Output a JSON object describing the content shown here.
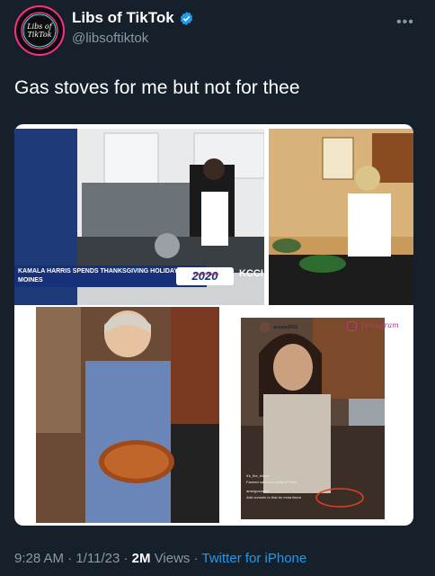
{
  "account": {
    "display_name": "Libs of TikTok",
    "handle": "@libsoftiktok",
    "avatar_text_line1": "Libs of",
    "avatar_text_line2": "TikTok"
  },
  "tweet": {
    "text": "Gas stoves for me but not for thee"
  },
  "media": {
    "chyron_text": "KAMALA HARRIS SPENDS THANKSGIVING HOLIDAY IN DES MOINES",
    "chyron_badge_small": "COUNTDOWN",
    "chyron_badge": "2020",
    "station_logo": "KCCI",
    "instagram_user": "ocasio2018",
    "instagram_brand": "Instagram",
    "comment_1_user": "it's_the_bloom",
    "comment_1_text": "Farmed salmon's pretty s**t tbh",
    "comment_2_user": "amargowayist",
    "comment_2_text": "Add cummin to that for extra flavor"
  },
  "footer": {
    "time": "9:28 AM",
    "date": "1/11/23",
    "views_count": "2M",
    "views_label": "Views",
    "source": "Twitter for iPhone",
    "separator": "·"
  },
  "colors": {
    "background": "#15202b",
    "secondary_text": "#8b98a5",
    "link": "#1d9bf0",
    "verified": "#1d9bf0"
  },
  "icons": [
    "verified-badge-icon",
    "more-options-icon",
    "instagram-icon"
  ]
}
